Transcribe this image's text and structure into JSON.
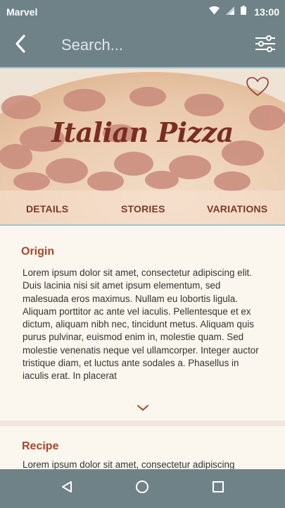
{
  "status_bar": {
    "carrier": "Marvel",
    "time": "13:00",
    "icons": [
      "wifi-icon",
      "signal-icon",
      "battery-icon"
    ]
  },
  "app_bar": {
    "back_icon": "chevron-left-icon",
    "search_placeholder": "Search...",
    "filter_icon": "sliders-icon"
  },
  "hero": {
    "title": "Italian Pizza",
    "favorite_icon": "heart-outline-icon",
    "tabs": [
      "DETAILS",
      "STORIES",
      "VARIATIONS"
    ]
  },
  "sections": [
    {
      "title": "Origin",
      "body": "Lorem ipsum dolor sit amet, consectetur adipiscing elit. Duis lacinia nisi sit amet ipsum elementum, sed malesuada eros maximus. Nullam eu lobortis ligula. Aliquam porttitor ac ante vel iaculis. Pellentesque et ex dictum, aliquam nibh nec, tincidunt metus. Aliquam quis purus pulvinar, euismod enim in, molestie quam. Sed molestie venenatis neque vel ullamcorper. Integer auctor tristique diam, et luctus ante sodales a. Phasellus in iaculis erat. In placerat",
      "expand_icon": "chevron-down-icon"
    },
    {
      "title": "Recipe",
      "body": "Lorem ipsum dolor sit amet, consectetur adipiscing"
    }
  ],
  "nav_bar": {
    "icons": [
      "back-triangle-icon",
      "home-circle-icon",
      "recents-square-icon"
    ]
  },
  "colors": {
    "bar": "#6f8287",
    "accent": "#a8472b",
    "title": "#7a2d22",
    "background": "#faf6ef"
  }
}
